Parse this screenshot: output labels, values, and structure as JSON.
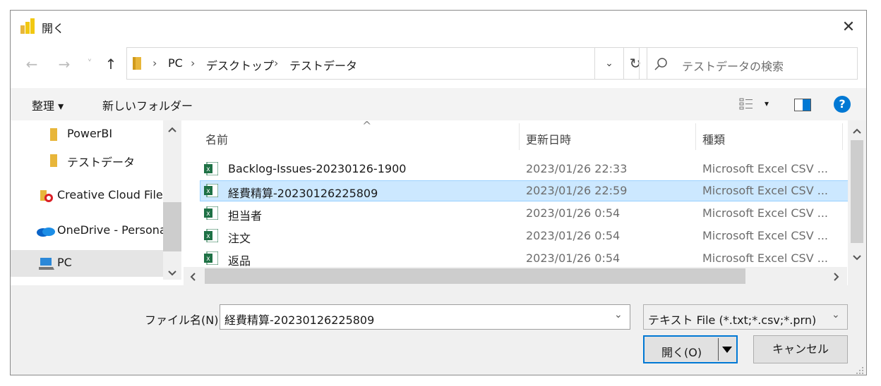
{
  "window": {
    "title": "開く",
    "close_glyph": "✕"
  },
  "nav": {
    "back": "←",
    "forward": "→",
    "recent": "˅",
    "up": "↑"
  },
  "breadcrumb": {
    "items": [
      "PC",
      "デスクトップ",
      "テストデータ"
    ],
    "separator": "›"
  },
  "address": {
    "dropdown": "⌄",
    "refresh": "↻"
  },
  "search": {
    "placeholder": "テストデータの検索"
  },
  "toolbar": {
    "organize": "整理 ▾",
    "new_folder": "新しいフォルダー",
    "view_arrow": "▾",
    "help": "?"
  },
  "sidebar": {
    "items": [
      {
        "label": "PowerBI",
        "icon": "folder-icon"
      },
      {
        "label": "テストデータ",
        "icon": "folder-icon"
      },
      {
        "label": "Creative Cloud Files",
        "icon": "creative-cloud-icon"
      },
      {
        "label": "OneDrive - Personal",
        "icon": "onedrive-icon"
      },
      {
        "label": "PC",
        "icon": "pc-icon",
        "selected": true
      }
    ]
  },
  "files": {
    "sort_indicator": "^",
    "columns": [
      "名前",
      "更新日時",
      "種類"
    ],
    "rows": [
      {
        "name": "Backlog-Issues-20230126-1900",
        "date": "2023/01/26 22:33",
        "type": "Microsoft Excel CSV ..."
      },
      {
        "name": "経費精算-20230126225809",
        "date": "2023/01/26 22:59",
        "type": "Microsoft Excel CSV ...",
        "selected": true
      },
      {
        "name": "担当者",
        "date": "2023/01/26 0:54",
        "type": "Microsoft Excel CSV ..."
      },
      {
        "name": "注文",
        "date": "2023/01/26 0:54",
        "type": "Microsoft Excel CSV ..."
      },
      {
        "name": "返品",
        "date": "2023/01/26 0:54",
        "type": "Microsoft Excel CSV ..."
      }
    ]
  },
  "footer": {
    "filename_label": "ファイル名(N):",
    "filename_value": "経費精算-20230126225809",
    "filetype_value": "テキスト File (*.txt;*.csv;*.prn)",
    "open_label": "開く(O)",
    "cancel_label": "キャンセル",
    "dropdown": "⌄"
  },
  "colors": {
    "accent": "#0078d4",
    "selection": "#cce8ff",
    "excel_green": "#1e7145",
    "folder": "#e8b63a"
  }
}
